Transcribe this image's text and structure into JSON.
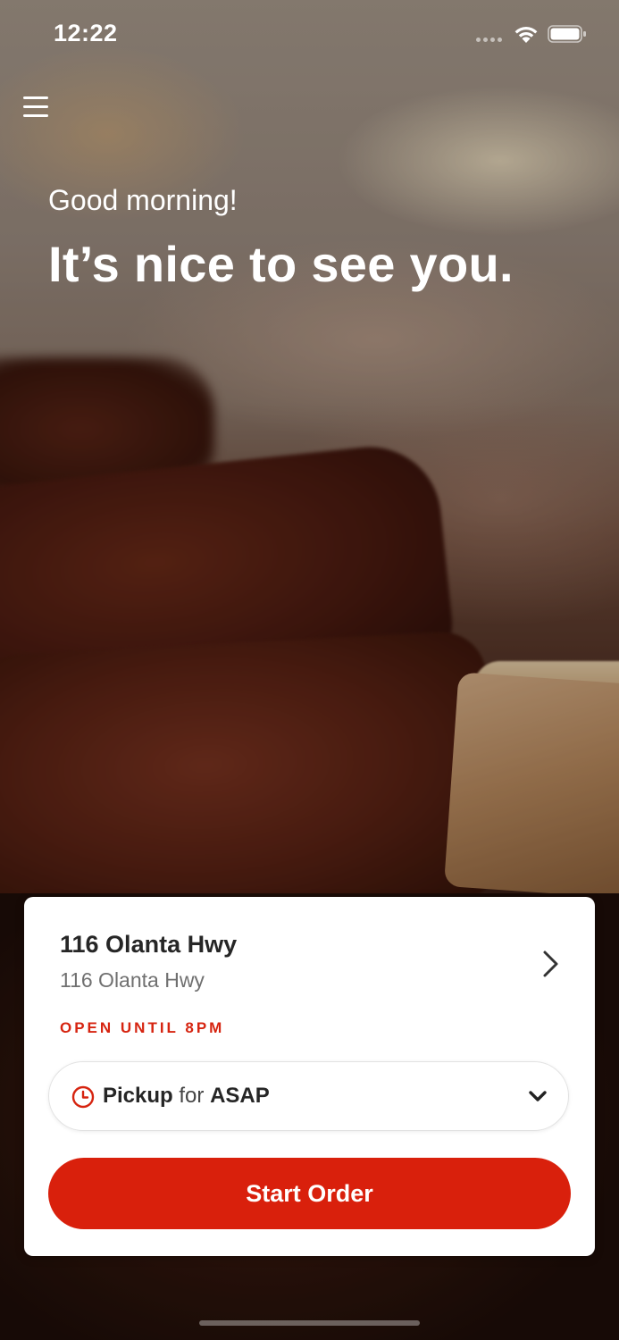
{
  "status_bar": {
    "time": "12:22"
  },
  "header": {
    "menu_icon": "hamburger-menu-icon"
  },
  "hero": {
    "greeting": "Good morning!",
    "headline": "It’s nice to see you."
  },
  "location_card": {
    "name": "116 Olanta Hwy",
    "address": "116 Olanta Hwy",
    "hours_status": "OPEN UNTIL 8PM",
    "chevron_icon": "chevron-right-icon",
    "order_type": {
      "mode": "Pickup",
      "connector": "for",
      "time": "ASAP",
      "icon": "clock-icon",
      "dropdown_icon": "chevron-down-icon"
    },
    "start_order_label": "Start Order"
  },
  "colors": {
    "accent": "#d9200c",
    "hours_status": "#d62410",
    "card_bg": "#ffffff"
  }
}
